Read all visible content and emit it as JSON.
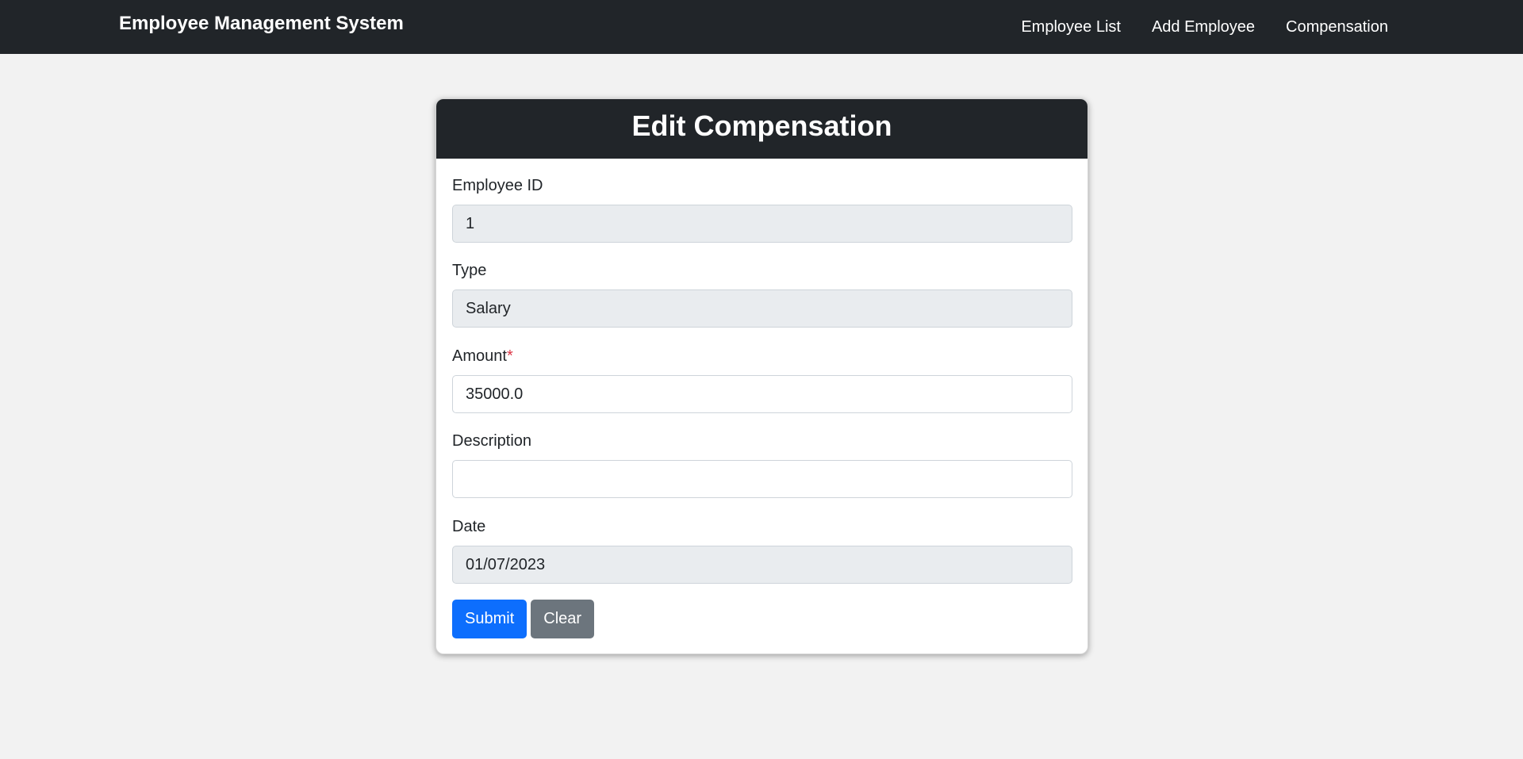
{
  "navbar": {
    "brand": "Employee Management System",
    "links": [
      "Employee List",
      "Add Employee",
      "Compensation"
    ]
  },
  "form": {
    "title": "Edit Compensation",
    "fields": {
      "employee_id": {
        "label": "Employee ID",
        "value": "1"
      },
      "type": {
        "label": "Type",
        "value": "Salary"
      },
      "amount": {
        "label": "Amount",
        "required_marker": "*",
        "value": "35000.0"
      },
      "description": {
        "label": "Description",
        "value": ""
      },
      "date": {
        "label": "Date",
        "value": "01/07/2023"
      }
    },
    "buttons": {
      "submit": "Submit",
      "clear": "Clear"
    }
  },
  "colors": {
    "navbar_bg": "#212529",
    "page_bg": "#f2f2f2",
    "primary": "#0d6efd",
    "secondary": "#6c757d",
    "required": "#dc3545",
    "readonly_bg": "#e9ecef"
  }
}
